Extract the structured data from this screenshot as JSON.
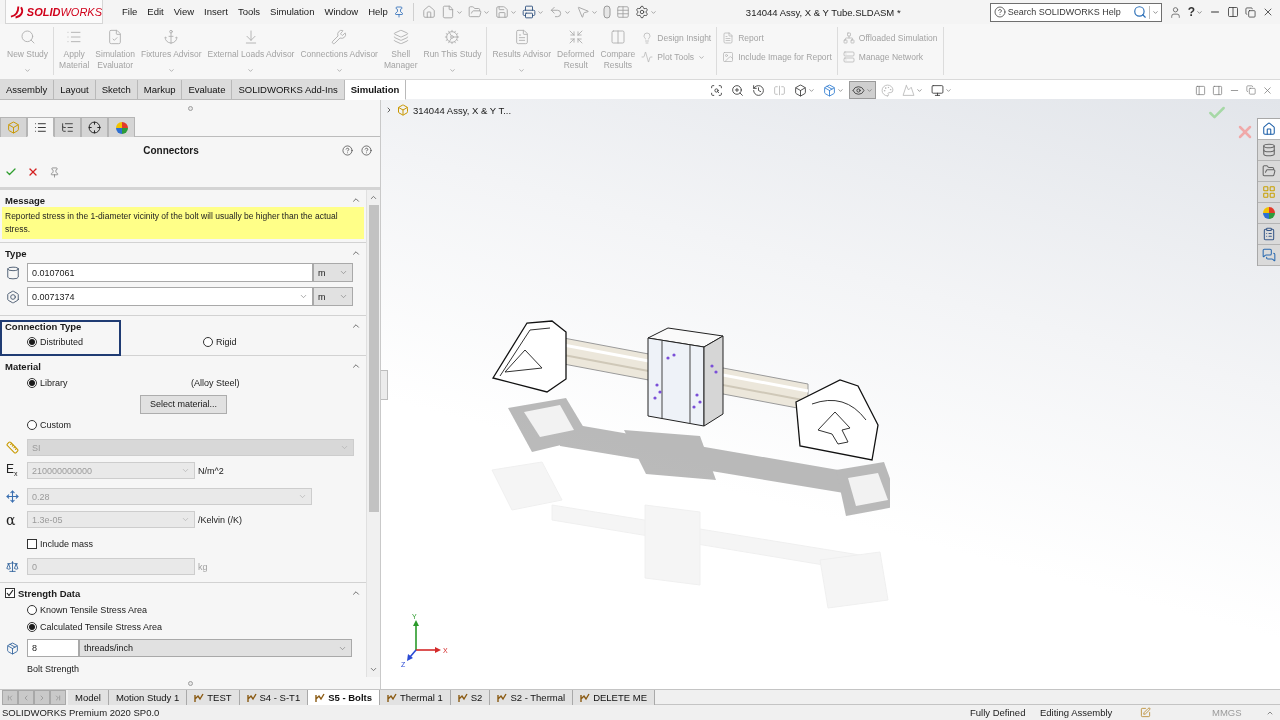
{
  "title_bar": {
    "brand": "**SOLID**WORKS",
    "menu": [
      "File",
      "Edit",
      "View",
      "Insert",
      "Tools",
      "Simulation",
      "Window",
      "Help"
    ],
    "document_title": "314044 Assy, X & Y Tube.SLDASM *",
    "search": {
      "placeholder": "Search SOLIDWORKS Help"
    },
    "help_menu": "?"
  },
  "ribbon": {
    "groups": [
      {
        "items": [
          {
            "kind": "large",
            "label": "New Study",
            "has_menu": true,
            "disabled": true
          }
        ]
      },
      {
        "items": [
          {
            "kind": "large",
            "label": "Apply Material",
            "has_menu": false,
            "disabled": true
          },
          {
            "kind": "large",
            "label": "Simulation Evaluator",
            "has_menu": false,
            "disabled": true
          },
          {
            "kind": "large",
            "label": "Fixtures Advisor",
            "has_menu": true,
            "disabled": true
          },
          {
            "kind": "large",
            "label": "External Loads Advisor",
            "has_menu": true,
            "disabled": true
          },
          {
            "kind": "large",
            "label": "Connections Advisor",
            "has_menu": true,
            "disabled": true
          },
          {
            "kind": "large",
            "label": "Shell Manager",
            "has_menu": false,
            "disabled": true
          },
          {
            "kind": "large",
            "label": "Run This Study",
            "has_menu": true,
            "disabled": true
          }
        ]
      },
      {
        "items": [
          {
            "kind": "large",
            "label": "Results Advisor",
            "has_menu": true,
            "disabled": true
          },
          {
            "kind": "large",
            "label": "Deformed Result",
            "has_menu": false,
            "disabled": true
          },
          {
            "kind": "large",
            "label": "Compare Results",
            "has_menu": false,
            "disabled": true
          },
          {
            "kind": "small",
            "label": "Design Insight",
            "has_menu": false,
            "disabled": true
          },
          {
            "kind": "small",
            "label": "Plot Tools",
            "has_menu": true,
            "disabled": true
          }
        ]
      },
      {
        "items": [
          {
            "kind": "small",
            "label": "Report",
            "has_menu": false,
            "disabled": true
          },
          {
            "kind": "small",
            "label": "Include Image for Report",
            "has_menu": false,
            "disabled": true
          }
        ]
      },
      {
        "items": [
          {
            "kind": "small",
            "label": "Offloaded Simulation",
            "has_menu": false,
            "disabled": true
          },
          {
            "kind": "small",
            "label": "Manage Network",
            "has_menu": false,
            "disabled": true
          }
        ]
      }
    ]
  },
  "command_tabs": [
    {
      "label": "Assembly",
      "selected": false
    },
    {
      "label": "Layout",
      "selected": false
    },
    {
      "label": "Sketch",
      "selected": false
    },
    {
      "label": "Markup",
      "selected": false
    },
    {
      "label": "Evaluate",
      "selected": false
    },
    {
      "label": "SOLIDWORKS Add-Ins",
      "selected": false
    },
    {
      "label": "Simulation",
      "selected": true
    }
  ],
  "view_toolbar": [
    {
      "kind": "zoom-fit",
      "selected": false,
      "disabled": false
    },
    {
      "kind": "zoom-area",
      "selected": false,
      "disabled": false
    },
    {
      "kind": "previous-view",
      "selected": false,
      "disabled": false
    },
    {
      "kind": "section-view",
      "selected": false,
      "disabled": true
    },
    {
      "kind": "view-orientation",
      "selected": false,
      "disabled": false
    },
    {
      "kind": "display-style",
      "selected": false,
      "disabled": false
    },
    {
      "kind": "hide-show",
      "selected": true,
      "disabled": false
    },
    {
      "kind": "appearance",
      "selected": false,
      "disabled": true
    },
    {
      "kind": "scene",
      "selected": false,
      "disabled": true
    },
    {
      "kind": "view-settings",
      "selected": false,
      "disabled": false
    }
  ],
  "property_manager": {
    "tabs": [
      {
        "kind": "feature-tree",
        "selected": false
      },
      {
        "kind": "properties",
        "selected": true
      },
      {
        "kind": "configurations",
        "selected": false
      },
      {
        "kind": "dimxpert",
        "selected": false
      },
      {
        "kind": "display",
        "selected": false
      }
    ],
    "title": "Connectors",
    "message": {
      "title": "Message",
      "expanded": true,
      "text": "Reported stress in the 1-diameter vicinity of the bolt will usually be higher than the actual stress."
    },
    "type_section": {
      "title": "Type",
      "expanded": true,
      "fields": [
        {
          "value": "0.0107061",
          "unit": "m",
          "dropdown": false
        },
        {
          "value": "0.0071374",
          "unit": "m",
          "dropdown": true
        }
      ]
    },
    "connection_type": {
      "title": "Connection Type",
      "expanded": true,
      "highlighted": true,
      "options": [
        {
          "label": "Distributed",
          "selected": true
        },
        {
          "label": "Rigid",
          "selected": false
        }
      ]
    },
    "material": {
      "title": "Material",
      "expanded": true,
      "sources": [
        {
          "label": "Library",
          "selected": true
        },
        {
          "label": "Custom",
          "selected": false
        }
      ],
      "library_material": "(Alloy Steel)",
      "select_button": "Select material...",
      "unit_system": {
        "value": "SI",
        "disabled": true
      },
      "properties": [
        {
          "kind": "elastic-modulus",
          "symbol": "E$_{x}$",
          "value": "210000000000",
          "unit": "N/m^2",
          "disabled": true
        },
        {
          "kind": "poisson-ratio",
          "value": "0.28",
          "disabled": true
        },
        {
          "kind": "thermal-expansion",
          "symbol": "α",
          "value": "1.3e-05",
          "unit": "/Kelvin (/K)",
          "disabled": true
        }
      ],
      "include_mass": {
        "label": "Include mass",
        "checked": false
      },
      "mass": {
        "value": "0",
        "unit": "kg",
        "disabled": true
      }
    },
    "strength_data": {
      "title": "Strength Data",
      "checked": true,
      "expanded": true,
      "options": [
        {
          "label": "Known Tensile Stress Area",
          "selected": false
        },
        {
          "label": "Calculated Tensile Stress Area",
          "selected": true
        }
      ],
      "threads": {
        "value": "8",
        "unit": "threads/inch"
      },
      "subheading": "Bolt Strength"
    }
  },
  "viewport": {
    "tree_root": "314044 Assy, X & Y T...",
    "triad": {
      "x": "X",
      "y": "Y",
      "z": "Z"
    }
  },
  "task_pane": [
    {
      "kind": "home",
      "selected": true
    },
    {
      "kind": "library",
      "selected": false
    },
    {
      "kind": "file-explorer",
      "selected": false
    },
    {
      "kind": "view-palette",
      "selected": false
    },
    {
      "kind": "appearances",
      "selected": false
    },
    {
      "kind": "custom-properties",
      "selected": false
    },
    {
      "kind": "forum",
      "selected": false
    }
  ],
  "document_tabs": [
    {
      "kind": "plain",
      "label": "Model",
      "selected": false
    },
    {
      "kind": "plain",
      "label": "Motion Study 1",
      "selected": false
    },
    {
      "kind": "study",
      "label": "TEST",
      "selected": false
    },
    {
      "kind": "study",
      "label": "S4 - S-T1",
      "selected": false
    },
    {
      "kind": "study",
      "label": "S5 - Bolts",
      "selected": true
    },
    {
      "kind": "study",
      "label": "Thermal 1",
      "selected": false
    },
    {
      "kind": "study",
      "label": "S2",
      "selected": false
    },
    {
      "kind": "study",
      "label": "S2 - Thermal",
      "selected": false
    },
    {
      "kind": "study",
      "label": "DELETE ME",
      "selected": false
    }
  ],
  "status_bar": {
    "product": "SOLIDWORKS Premium 2020 SP0.0",
    "state": "Fully Defined",
    "mode": "Editing Assembly",
    "units": "MMGS"
  }
}
